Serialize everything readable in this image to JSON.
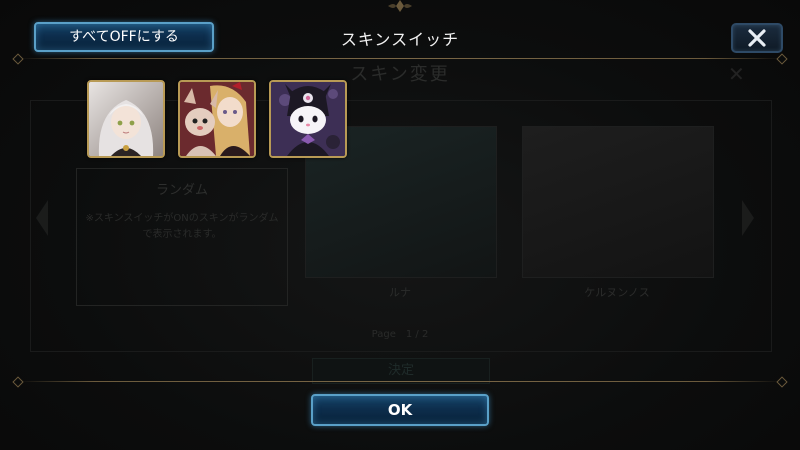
{
  "dialog": {
    "title": "スキンスイッチ",
    "all_off_label": "すべてOFFにする",
    "close_icon": "close-icon",
    "ok_label": "OK",
    "skins": [
      {
        "name": "silver-hair-girl-portrait"
      },
      {
        "name": "blonde-girl-with-plush-portrait"
      },
      {
        "name": "kuromi-portrait"
      }
    ]
  },
  "background": {
    "title": "スキン変更",
    "random_label": "ランダム",
    "random_desc": "※スキンスイッチがONのスキンがランダムで表示されます。",
    "card1_name": "ルナ",
    "card2_name": "ケルヌンノス",
    "page_label": "Page　1 / 2",
    "decide_label": "決定"
  },
  "colors": {
    "accent_blue": "#5aa0c8",
    "frame_gold": "#b89a55"
  }
}
